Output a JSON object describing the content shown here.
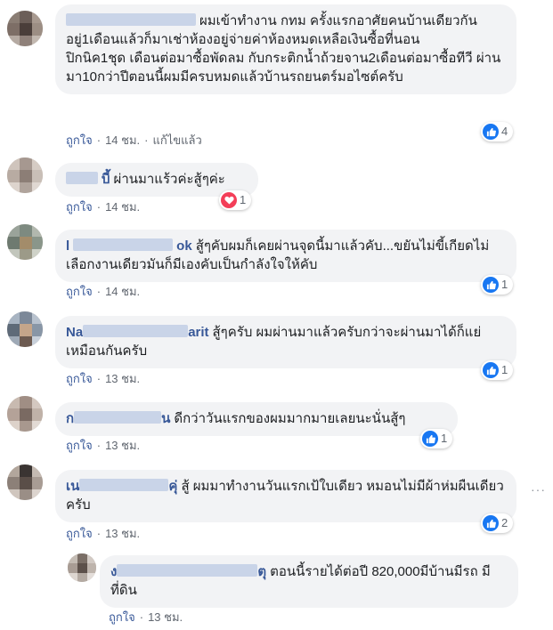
{
  "colors": {
    "link": "#385898",
    "like": "#1877f2",
    "love": "#f33e58",
    "bubble": "#f2f3f5"
  },
  "comments": [
    {
      "author": "",
      "text": "ผมเข้าทำงาน กทม ครั้งแรกอาศัยคนบ้านเดียวกันอยู่1เดือนแล้วก็มาเช่าห้องอยู่จ่ายค่าห้องหมดเหลือเงินซื้อที่นอน",
      "text2": "ปิกนิค1ชุด เดือนต่อมาซื้อพัดลม กับกระติกน้ำถ้วยจาน2เดือนต่อมาซื้อทีวี ผ่านมา10กว่าปีตอนนี้ผมมีครบหมดแล้วบ้านรถยนตร์มอไซต์ครับ",
      "like": "ถูกใจ",
      "time": "14 ชม.",
      "edited": "แก้ไขแล้ว",
      "reaction": {
        "icon": "like-icon",
        "count": "4"
      }
    },
    {
      "author": "บี้",
      "text": "ผ่านมาแร้วค่ะสู้ๆค่ะ",
      "like": "ถูกใจ",
      "time": "14 ชม.",
      "reaction": {
        "icon": "love-icon",
        "count": "1"
      }
    },
    {
      "author": "ok",
      "text": "สู้ๆคับผมก็เคยผ่านจุดนี้มาแล้วคับ...ขยันไม่ขี้เกียดไม่เลือกงานเดียวมันก็มีเองคับเป็นกำลังใจให้คับ",
      "like": "ถูกใจ",
      "time": "14 ชม.",
      "reaction": {
        "icon": "like-icon",
        "count": "1"
      }
    },
    {
      "author_start": "Na",
      "author_end": "arit",
      "text": "สู้ๆครับ ผมผ่านมาแล้วครับกว่าจะผ่านมาได้ก็แย่เหมือนกันครับ",
      "like": "ถูกใจ",
      "time": "13 ชม.",
      "reaction": {
        "icon": "like-icon",
        "count": "1"
      }
    },
    {
      "author_start": "ก",
      "author_end": "น",
      "text": "ดีกว่าวันแรกของผมมากมายเลยนะนั่นสู้ๆ",
      "like": "ถูกใจ",
      "time": "13 ชม.",
      "reaction": {
        "icon": "like-icon",
        "count": "1"
      }
    },
    {
      "author_start": "เน",
      "author_end": "คุ่",
      "text": "สู้ ผมมาทำงานวันแรกเป้ใบเดียว หมอนไม่มีผ้าห่มผืนเดียวครับ",
      "like": "ถูกใจ",
      "time": "13 ชม.",
      "reaction": {
        "icon": "like-icon",
        "count": "2"
      },
      "menu": "···"
    },
    {
      "author": "ตุ",
      "text": "ตอนนี้รายได้ต่อปี 820,000มีบ้านมีรถ มีที่ดิน",
      "like": "ถูกใจ",
      "time": "13 ชม."
    }
  ]
}
